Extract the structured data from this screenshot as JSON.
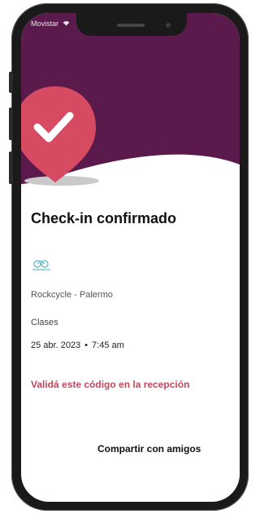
{
  "status_bar": {
    "carrier": "Movistar",
    "wifi_icon": "wifi-icon"
  },
  "checkin": {
    "title": "Check-in confirmado",
    "venue": "Rockcycle - Palermo",
    "category": "Clases",
    "date": "25 abr. 2023",
    "separator": "•",
    "time": "7:45 am",
    "validate_text": "Validá este código en la recepción",
    "share_label": "Compartir con amigos"
  },
  "icons": {
    "pin": "check-location-pin-icon",
    "logo": "rockcycle-logo"
  },
  "colors": {
    "header": "#5a1a4c",
    "pin": "#d64a62",
    "accent": "#c0485d"
  }
}
